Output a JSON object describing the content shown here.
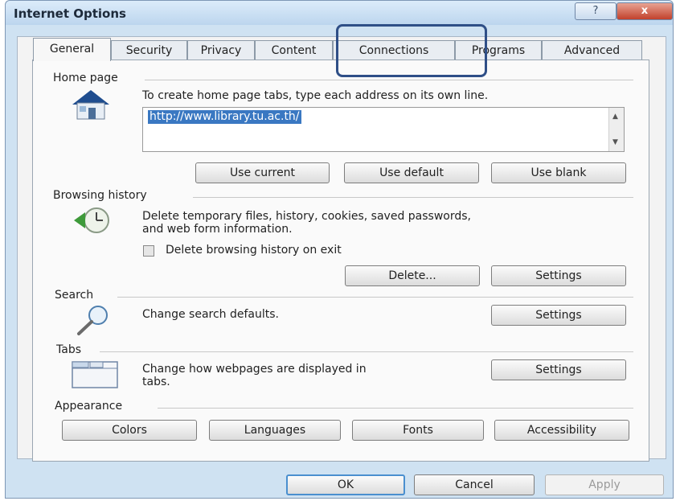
{
  "window": {
    "title": "Internet Options",
    "help_label": "?",
    "close_label": "x"
  },
  "tabs": [
    {
      "label": "General"
    },
    {
      "label": "Security"
    },
    {
      "label": "Privacy"
    },
    {
      "label": "Content"
    },
    {
      "label": "Connections"
    },
    {
      "label": "Programs"
    },
    {
      "label": "Advanced"
    }
  ],
  "active_tab": "General",
  "highlighted_tab": "Connections",
  "home_page": {
    "group_label": "Home page",
    "description": "To create home page tabs, type each address on its own line.",
    "url": "http://www.library.tu.ac.th/",
    "use_current": "Use current",
    "use_default": "Use default",
    "use_blank": "Use blank"
  },
  "browsing_history": {
    "group_label": "Browsing history",
    "description_line1": "Delete temporary files, history, cookies, saved passwords,",
    "description_line2": "and web form information.",
    "checkbox_label": "Delete browsing history on exit",
    "checkbox_checked": false,
    "delete_button": "Delete...",
    "settings_button": "Settings"
  },
  "search": {
    "group_label": "Search",
    "description": "Change search defaults.",
    "settings_button": "Settings"
  },
  "tabs_group": {
    "group_label": "Tabs",
    "description_line1": "Change how webpages are displayed in",
    "description_line2": "tabs.",
    "settings_button": "Settings"
  },
  "appearance": {
    "group_label": "Appearance",
    "colors": "Colors",
    "languages": "Languages",
    "fonts": "Fonts",
    "accessibility": "Accessibility"
  },
  "footer": {
    "ok": "OK",
    "cancel": "Cancel",
    "apply": "Apply"
  },
  "colors": {
    "highlight": "#2f4f87",
    "url_selection": "#3a78c2",
    "close": "#c2412c"
  }
}
